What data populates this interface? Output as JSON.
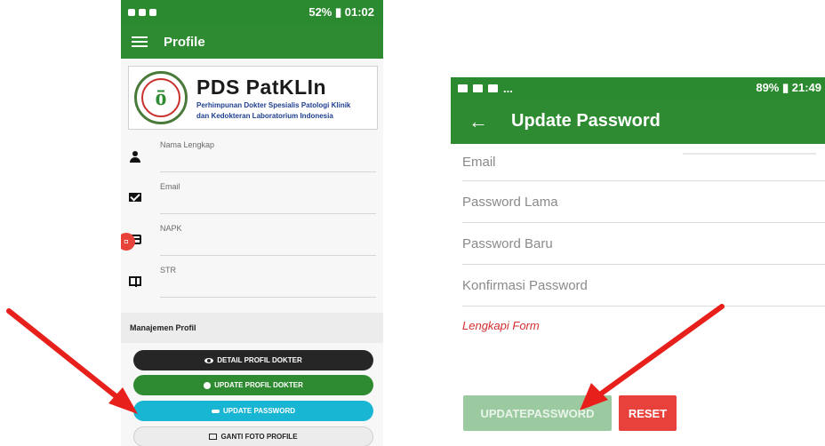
{
  "left_screen": {
    "status_bar": {
      "right_text": "52% ▮ 01:02"
    },
    "app_bar": {
      "title": "Profile"
    },
    "logo": {
      "title": "PDS PatKLIn",
      "subtitle_line1": "Perhimpunan Dokter Spesialis Patologi Klinik",
      "subtitle_line2": "dan Kedokteran Laboratorium Indonesia"
    },
    "fields": [
      {
        "label": "Nama Lengkap",
        "icon": "person-icon"
      },
      {
        "label": "Email",
        "icon": "mail-icon"
      },
      {
        "label": "NAPK",
        "icon": "card-icon"
      },
      {
        "label": "STR",
        "icon": "book-icon"
      }
    ],
    "section_title": "Manajemen Profil",
    "buttons": {
      "detail": "DETAIL PROFIL DOKTER",
      "update_profile": "UPDATE PROFIL DOKTER",
      "update_password": "UPDATE PASSWORD",
      "change_photo": "GANTI FOTO PROFILE"
    }
  },
  "right_screen": {
    "status_bar": {
      "left_text": "...",
      "right_text": "89% ▮ 21:49"
    },
    "app_bar": {
      "title": "Update Password"
    },
    "fields": [
      {
        "label": "Email"
      },
      {
        "label": "Password Lama"
      },
      {
        "label": "Password Baru"
      },
      {
        "label": "Konfirmasi Password"
      }
    ],
    "error_text": "Lengkapi Form",
    "buttons": {
      "update": "UPDATEPASSWORD",
      "reset": "RESET"
    }
  },
  "colors": {
    "app_green": "#2e8b31",
    "button_cyan": "#19b6d3",
    "reset_red": "#e8413c",
    "arrow_red": "#e8201c"
  }
}
